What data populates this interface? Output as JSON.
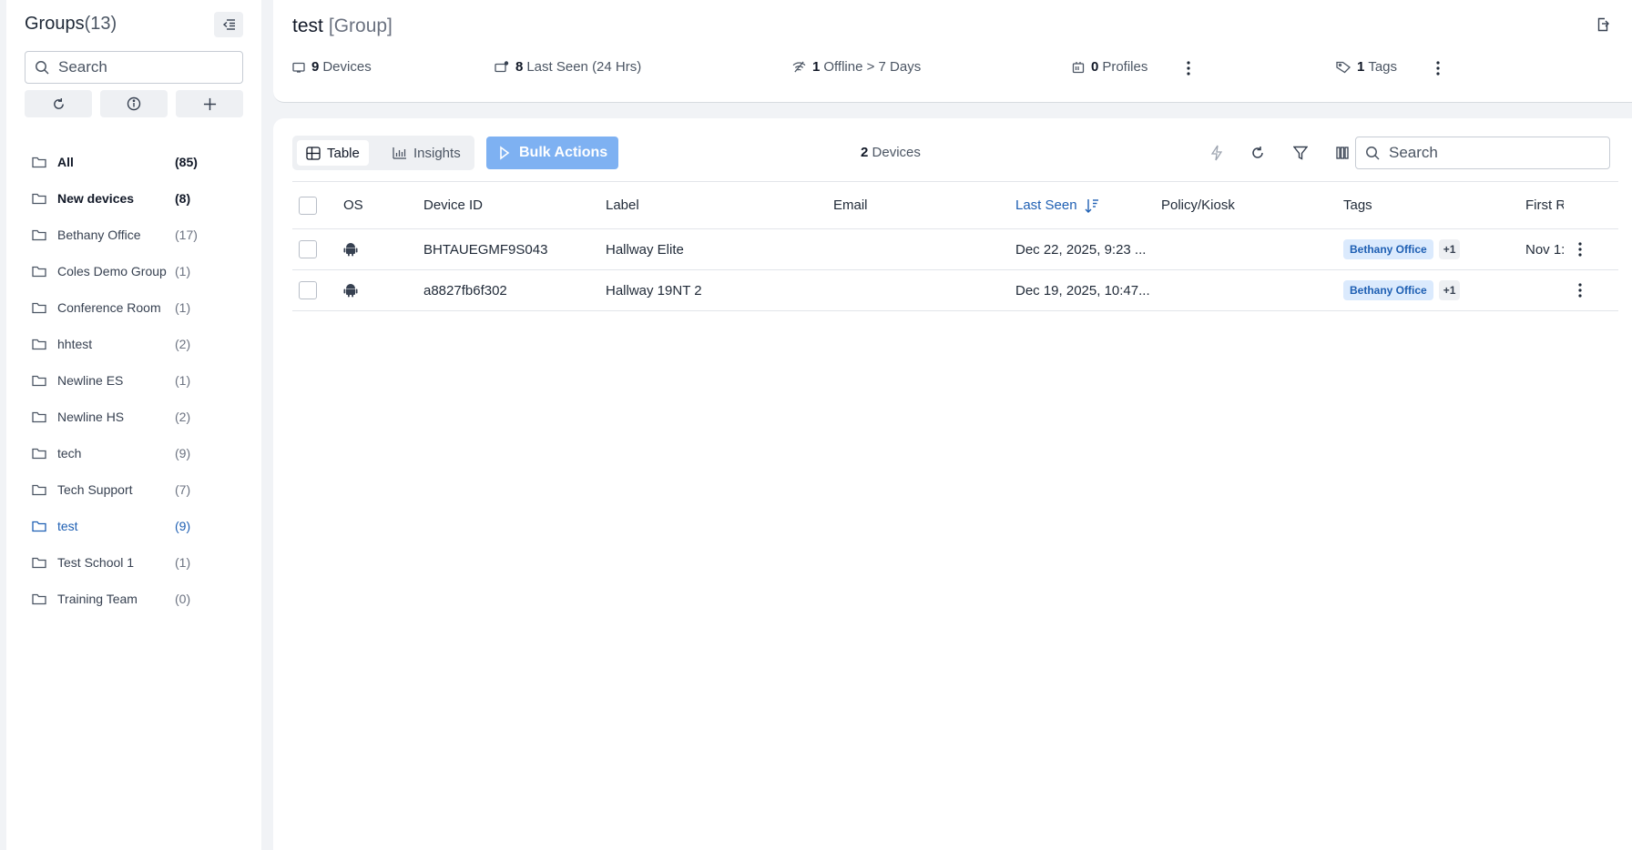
{
  "sidebar": {
    "title": "Groups",
    "title_count": "(13)",
    "search_placeholder": "Search",
    "items": [
      {
        "label": "All",
        "count": "(85)",
        "icon": "folder-icon"
      },
      {
        "label": "New devices",
        "count": "(8)",
        "icon": "folder-icon"
      },
      {
        "label": "Bethany Office",
        "count": "(17)",
        "icon": "folder-icon"
      },
      {
        "label": "Coles Demo Group",
        "count": "(1)",
        "icon": "folder-icon"
      },
      {
        "label": "Conference Room",
        "count": "(1)",
        "icon": "folder-icon"
      },
      {
        "label": "hhtest",
        "count": "(2)",
        "icon": "folder-icon"
      },
      {
        "label": "Newline ES",
        "count": "(1)",
        "icon": "folder-icon"
      },
      {
        "label": "Newline HS",
        "count": "(2)",
        "icon": "folder-icon"
      },
      {
        "label": "tech",
        "count": "(9)",
        "icon": "folder-icon"
      },
      {
        "label": "Tech Support",
        "count": "(7)",
        "icon": "folder-icon"
      },
      {
        "label": "test",
        "count": "(9)",
        "icon": "folder-icon"
      },
      {
        "label": "Test School 1",
        "count": "(1)",
        "icon": "folder-icon"
      },
      {
        "label": "Training Team",
        "count": "(0)",
        "icon": "folder-icon"
      }
    ],
    "active_item": "test"
  },
  "header": {
    "title": "test",
    "subtitle": "[Group]",
    "stats": {
      "devices": {
        "value": "9",
        "label": "Devices"
      },
      "last_seen": {
        "value": "8",
        "label": "Last Seen (24 Hrs)"
      },
      "offline": {
        "value": "1",
        "label": "Offline > 7 Days"
      },
      "profiles": {
        "value": "0",
        "label": "Profiles"
      },
      "tags": {
        "value": "1",
        "label": "Tags"
      }
    }
  },
  "toolbar": {
    "tab_table": "Table",
    "tab_insights": "Insights",
    "bulk_actions": "Bulk Actions",
    "device_count": "2",
    "device_count_label": "Devices",
    "search_placeholder": "Search"
  },
  "table": {
    "columns": [
      "OS",
      "Device ID",
      "Label",
      "Email",
      "Last Seen",
      "Policy/Kiosk",
      "Tags",
      "First R"
    ],
    "sorted_column": "Last Seen",
    "rows": [
      {
        "os": "android-icon",
        "device_id": "BHTAUEGMF9S043",
        "label": "Hallway Elite",
        "email": "",
        "last_seen": "Dec 22, 2025, 9:23 ...",
        "policy": "",
        "tag": "Bethany Office",
        "tag_more": "+1",
        "first": "Nov 1:"
      },
      {
        "os": "android-icon",
        "device_id": "a8827fb6f302",
        "label": "Hallway 19NT 2",
        "email": "",
        "last_seen": "Dec 19, 2025, 10:47...",
        "policy": "",
        "tag": "Bethany Office",
        "tag_more": "+1",
        "first": ""
      }
    ]
  },
  "colors": {
    "accent": "#1e5fb3",
    "bulk_button": "#7eb1f2",
    "tag_bg": "#dbeafd",
    "background": "#f1f3f6"
  }
}
